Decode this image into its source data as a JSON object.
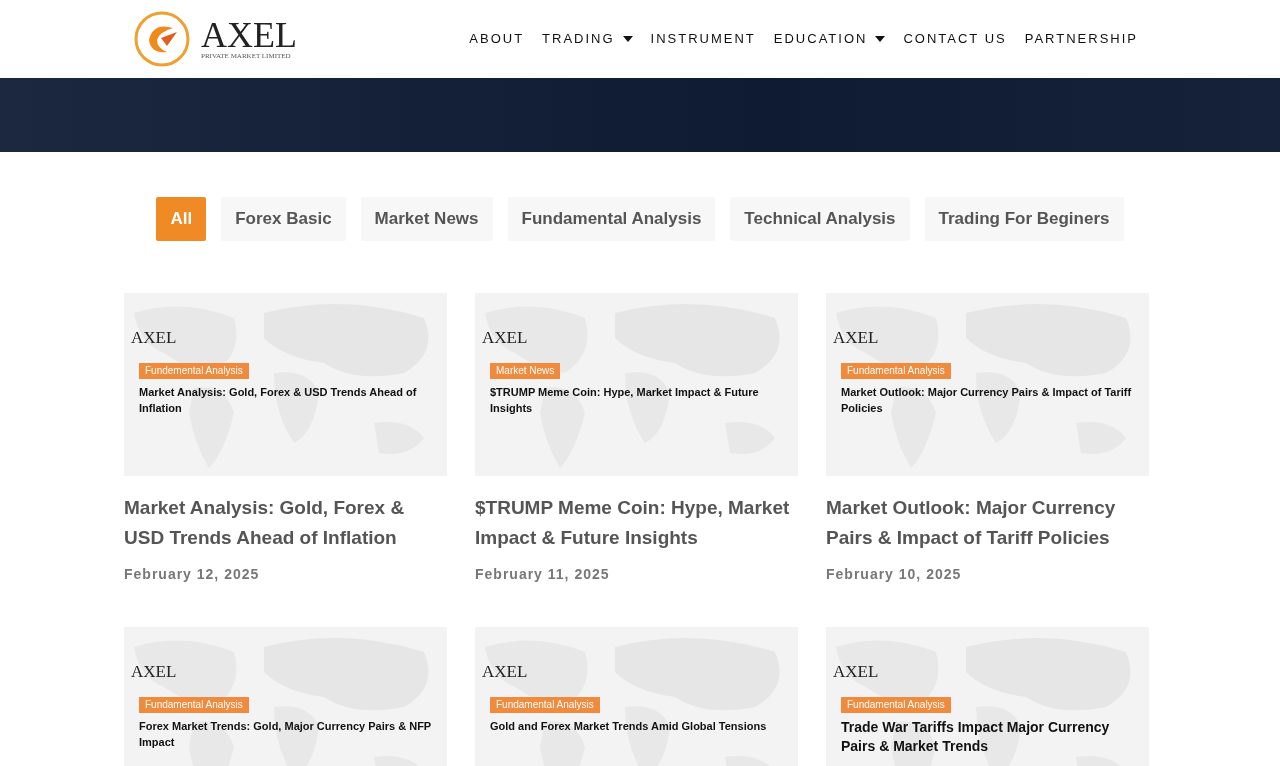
{
  "logo": {
    "name": "AXEL",
    "tagline": "PRIVATE MARKET LIMITED"
  },
  "nav": [
    {
      "label": "ABOUT",
      "dropdown": false
    },
    {
      "label": "TRADING",
      "dropdown": true
    },
    {
      "label": "INSTRUMENT",
      "dropdown": false
    },
    {
      "label": "EDUCATION",
      "dropdown": true
    },
    {
      "label": "CONTACT US",
      "dropdown": false
    },
    {
      "label": "PARTNERSHIP",
      "dropdown": false
    }
  ],
  "filters": [
    {
      "label": "All",
      "selected": true
    },
    {
      "label": "Forex Basic",
      "selected": false
    },
    {
      "label": "Market News",
      "selected": false
    },
    {
      "label": "Fundamental Analysis",
      "selected": false
    },
    {
      "label": "Technical Analysis",
      "selected": false
    },
    {
      "label": "Trading For Beginers",
      "selected": false
    }
  ],
  "posts": [
    {
      "thumbnail": {
        "brand": "AXEL",
        "tag": "Fundemental Analysis",
        "headline": "Market Analysis: Gold, Forex & USD Trends Ahead of Inflation",
        "large": false
      },
      "title": "Market Analysis: Gold, Forex & USD Trends Ahead of Inflation",
      "date": "February 12, 2025"
    },
    {
      "thumbnail": {
        "brand": "AXEL",
        "tag": "Market News",
        "headline": "$TRUMP Meme Coin: Hype, Market Impact & Future Insights",
        "large": false
      },
      "title": "$TRUMP Meme Coin: Hype, Market Impact & Future Insights",
      "date": "February 11, 2025"
    },
    {
      "thumbnail": {
        "brand": "AXEL",
        "tag": "Fundamental Analysis",
        "headline": "Market Outlook: Major Currency Pairs & Impact of Tariff Policies",
        "large": false
      },
      "title": "Market Outlook: Major Currency Pairs & Impact of Tariff Policies",
      "date": "February 10, 2025"
    },
    {
      "thumbnail": {
        "brand": "AXEL",
        "tag": "Fundamental Analysis",
        "headline": "Forex Market Trends: Gold, Major Currency Pairs & NFP Impact",
        "large": false
      }
    },
    {
      "thumbnail": {
        "brand": "AXEL",
        "tag": "Fundamental Analysis",
        "headline": "Gold and Forex Market Trends Amid Global Tensions",
        "large": false
      }
    },
    {
      "thumbnail": {
        "brand": "AXEL",
        "tag": "Fundamental Analysis",
        "headline": "Trade War Tariffs Impact Major Currency Pairs & Market Trends",
        "large": true
      }
    }
  ]
}
